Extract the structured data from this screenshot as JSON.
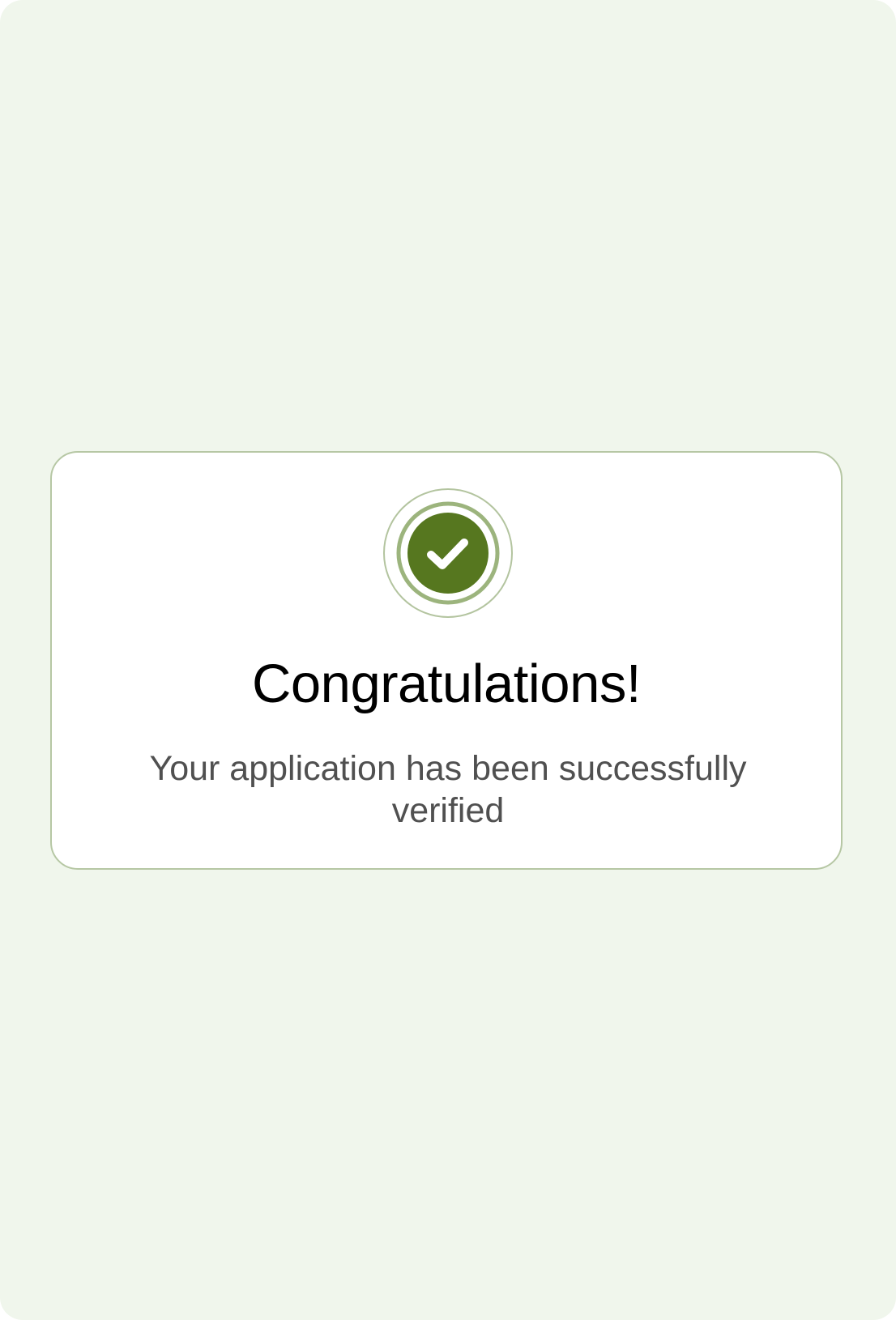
{
  "colors": {
    "background": "#f0f6ec",
    "card_border": "#b6c7a4",
    "accent": "#56771f",
    "ring": "#9cb47d",
    "title": "#000000",
    "subtitle": "#505050"
  },
  "success_card": {
    "icon": "check-circle-icon",
    "title": "Congratulations!",
    "message": "Your application has been successfully verified"
  }
}
